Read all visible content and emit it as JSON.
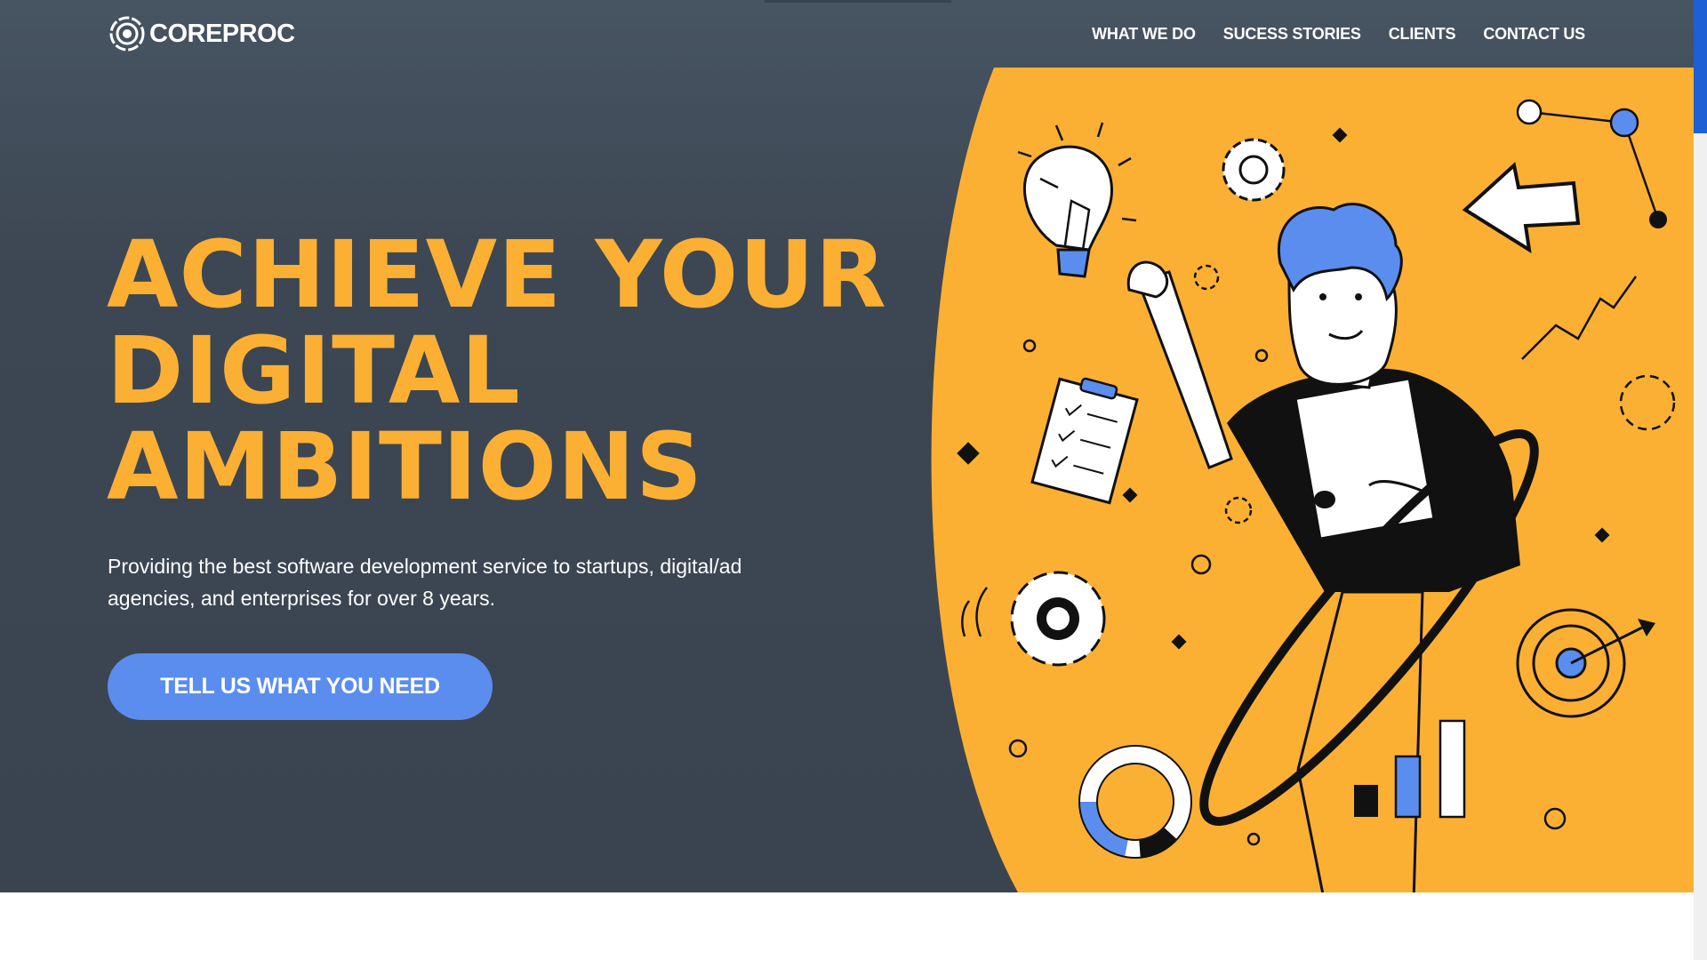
{
  "brand": {
    "name": "COREPROC"
  },
  "nav": {
    "items": [
      {
        "label": "WHAT WE DO"
      },
      {
        "label": "SUCESS STORIES"
      },
      {
        "label": "CLIENTS"
      },
      {
        "label": "CONTACT US"
      }
    ]
  },
  "hero": {
    "headline_lines": [
      "ACHIEVE YOUR",
      "DIGITAL",
      "AMBITIONS"
    ],
    "subtitle": "Providing the best software development service to startups, digital/ad agencies, and enterprises for over 8 years.",
    "cta_label": "TELL US WHAT YOU NEED"
  },
  "colors": {
    "hero_bg": "#3d4753",
    "accent_yellow": "#fbb034",
    "cta_blue": "#5b8def",
    "scroll_thumb": "#1f5fd6"
  },
  "illustration": {
    "icons": [
      "lightbulb-icon",
      "gear-icon",
      "arrow-cursor-icon",
      "clipboard-icon",
      "person-with-tablet",
      "target-icon",
      "bar-chart-icon",
      "donut-chart-icon"
    ]
  }
}
